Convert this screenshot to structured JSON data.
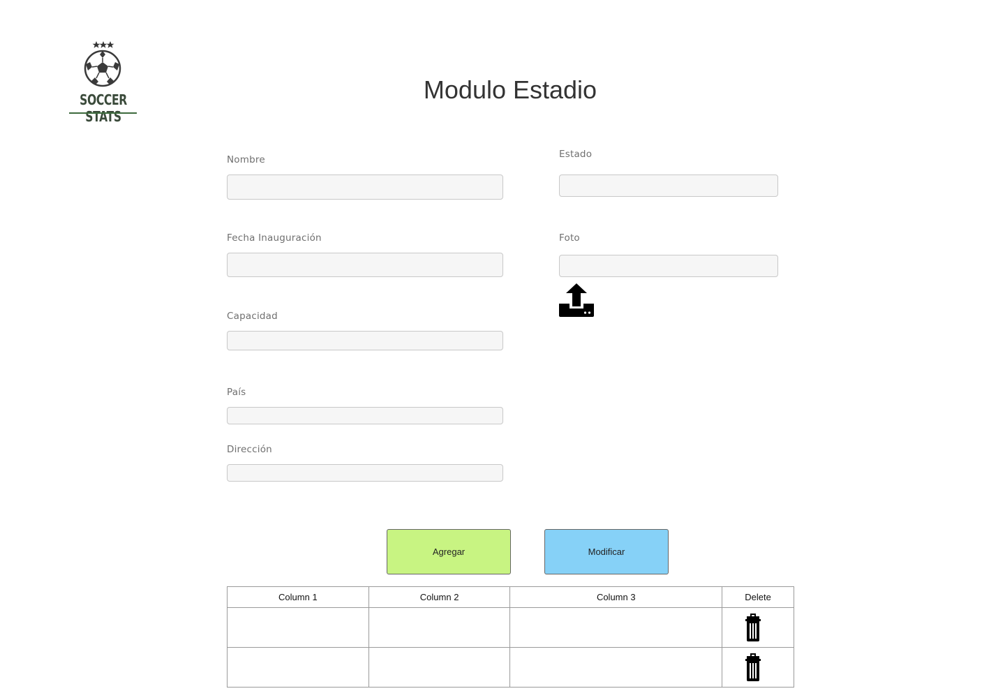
{
  "logo": {
    "text": "SOCCER STATS"
  },
  "page": {
    "title": "Modulo Estadio"
  },
  "form": {
    "nombre": {
      "label": "Nombre",
      "value": "",
      "placeholder": ""
    },
    "estado": {
      "label": "Estado",
      "value": "",
      "placeholder": ""
    },
    "fecha": {
      "label": "Fecha Inauguración",
      "value": "",
      "placeholder": ""
    },
    "foto": {
      "label": "Foto",
      "value": "",
      "placeholder": ""
    },
    "capacidad": {
      "label": "Capacidad",
      "value": "",
      "placeholder": ""
    },
    "pais": {
      "label": "País",
      "value": "",
      "placeholder": ""
    },
    "direccion": {
      "label": "Dirección",
      "value": "",
      "placeholder": ""
    },
    "upload_icon": "upload-icon"
  },
  "buttons": {
    "agregar": {
      "label": "Agregar",
      "color": "#c8f482"
    },
    "modificar": {
      "label": "Modificar",
      "color": "#86d1f7"
    }
  },
  "table": {
    "headers": [
      "Column 1",
      "Column 2",
      "Column 3",
      "Delete"
    ],
    "rows": [
      {
        "cells": [
          "",
          "",
          ""
        ],
        "delete_icon": "trash-icon"
      },
      {
        "cells": [
          "",
          "",
          ""
        ],
        "delete_icon": "trash-icon"
      }
    ]
  }
}
